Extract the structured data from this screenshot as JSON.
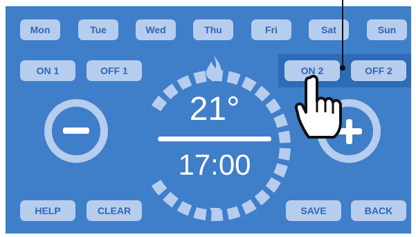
{
  "days": [
    "Mon",
    "Tue",
    "Wed",
    "Thu",
    "Fri",
    "Sat",
    "Sun"
  ],
  "program": {
    "on1": "ON 1",
    "off1": "OFF 1",
    "on2": "ON 2",
    "off2": "OFF 2"
  },
  "display": {
    "temperature": "21°",
    "time": "17:00"
  },
  "controls": {
    "decrease": "−",
    "increase": "+"
  },
  "footer": {
    "help": "HELP",
    "clear": "CLEAR",
    "save": "SAVE",
    "back": "BACK"
  },
  "icons": {
    "flame": "flame-icon",
    "cursor": "hand-pointer-icon",
    "decrease": "minus-icon",
    "increase": "plus-icon"
  },
  "colors": {
    "screen": "#3f7ec9",
    "button": "#b7cdee",
    "button_text": "#2f66b3",
    "highlight": "#2e6bb5",
    "foreground": "#ffffff"
  }
}
